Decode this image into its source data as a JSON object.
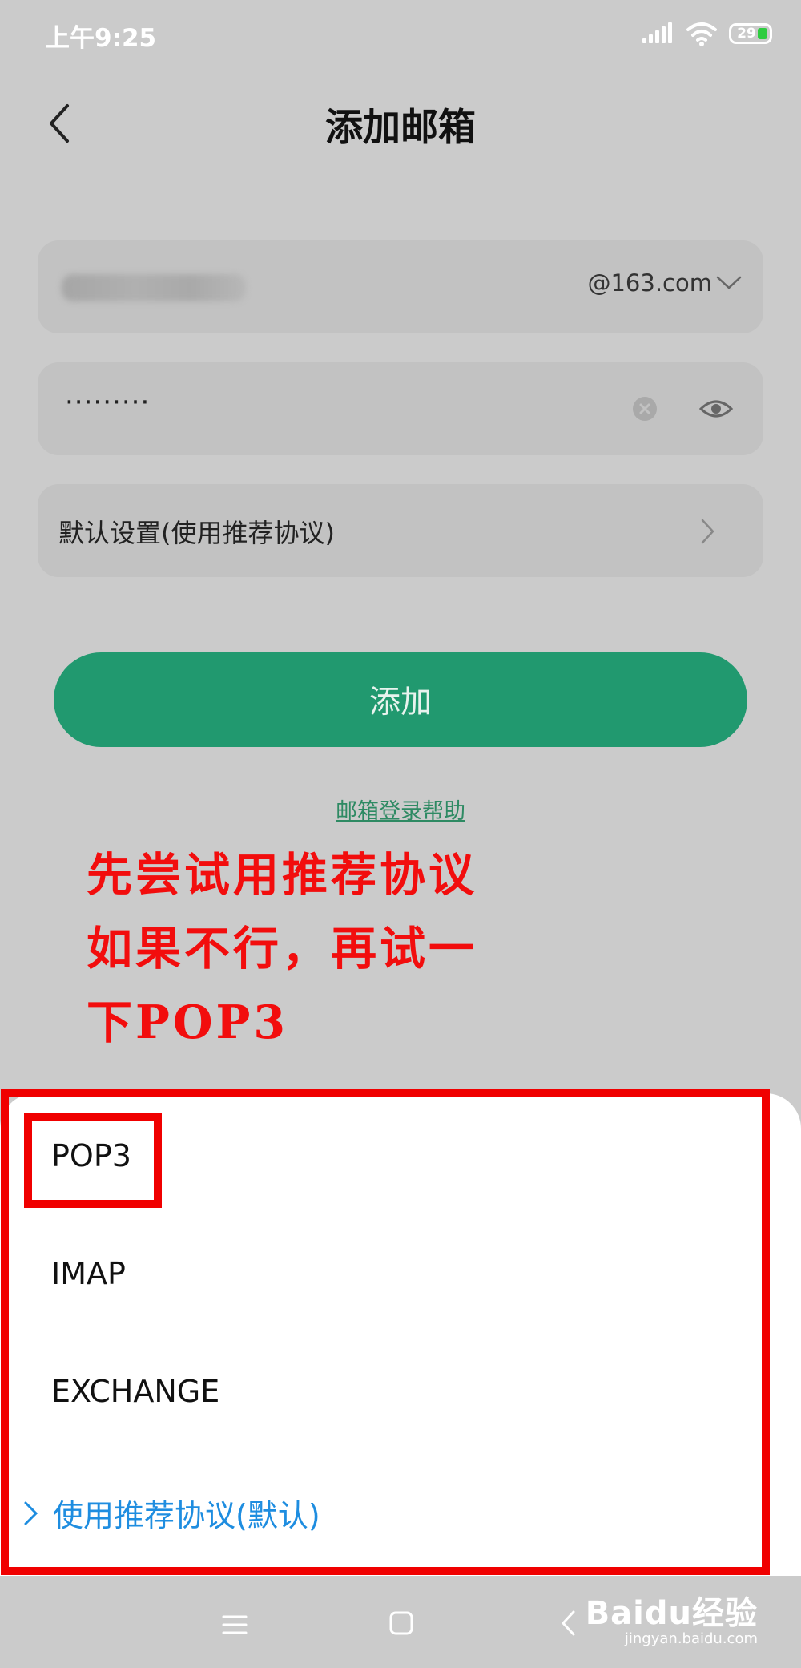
{
  "status_bar": {
    "time": "上午9:25",
    "battery_level": "29"
  },
  "header": {
    "title": "添加邮箱"
  },
  "form": {
    "email_value": "18772693986",
    "email_domain": "@163.com",
    "password_value": "·········",
    "settings_label": "默认设置(使用推荐协议)",
    "add_button_label": "添加",
    "help_link": "邮箱登录帮助"
  },
  "annotation": {
    "lines": [
      "先尝试用推荐协议",
      "如果不行，再试一",
      "下POP3"
    ],
    "color": "#f20d0d"
  },
  "protocol_sheet": {
    "options": [
      "POP3",
      "IMAP",
      "EXCHANGE"
    ],
    "selected_option": "使用推荐协议(默认)",
    "selected_color": "#1e8de0"
  },
  "watermark": {
    "logo": "Baidu经验",
    "url": "jingyan.baidu.com"
  },
  "colors": {
    "accent": "#21996f",
    "highlight_border": "#f00000"
  }
}
